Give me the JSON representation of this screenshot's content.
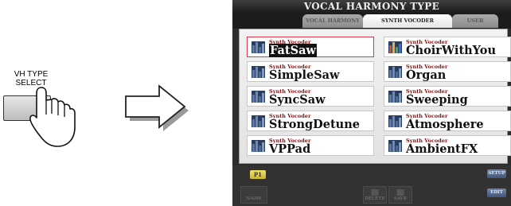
{
  "panel_button": {
    "label_line1": "VH TYPE",
    "label_line2": "SELECT"
  },
  "screen": {
    "title": "VOCAL HARMONY TYPE",
    "tabs": [
      {
        "label": "VOCAL HARMONY",
        "active": false
      },
      {
        "label": "SYNTH VOCODER",
        "active": true
      },
      {
        "label": "USER",
        "active": false
      }
    ],
    "items": [
      {
        "category": "Synth Vocoder",
        "name": "FatSaw",
        "selected": true,
        "icon": "vocoder-bars-icon"
      },
      {
        "category": "Synth Vocoder",
        "name": "ChoirWithYou",
        "selected": false,
        "icon": "vocoder-rainbow-icon"
      },
      {
        "category": "Synth Vocoder",
        "name": "SimpleSaw",
        "selected": false,
        "icon": "vocoder-bars-icon"
      },
      {
        "category": "Synth Vocoder",
        "name": "Organ",
        "selected": false,
        "icon": "vocoder-bars-icon"
      },
      {
        "category": "Synth Vocoder",
        "name": "SyncSaw",
        "selected": false,
        "icon": "vocoder-bars-icon"
      },
      {
        "category": "Synth Vocoder",
        "name": "Sweeping",
        "selected": false,
        "icon": "vocoder-bars-icon"
      },
      {
        "category": "Synth Vocoder",
        "name": "StrongDetune",
        "selected": false,
        "icon": "vocoder-bars-icon"
      },
      {
        "category": "Synth Vocoder",
        "name": "Atmosphere",
        "selected": false,
        "icon": "vocoder-bars-icon"
      },
      {
        "category": "Synth Vocoder",
        "name": "VPPad",
        "selected": false,
        "icon": "vocoder-bars-icon"
      },
      {
        "category": "Synth Vocoder",
        "name": "AmbientFX",
        "selected": false,
        "icon": "vocoder-bars-icon"
      }
    ],
    "page": "P1",
    "bottom_buttons": {
      "setup": "SETUP",
      "edit": "EDIT",
      "name": "NAME",
      "delete": "DELETE",
      "save": "SAVE"
    }
  },
  "colors": {
    "selection_border": "#d93a4b",
    "category_text": "#8a1010",
    "page_button": "#e3cf4a",
    "side_button": "#5a6f92"
  }
}
